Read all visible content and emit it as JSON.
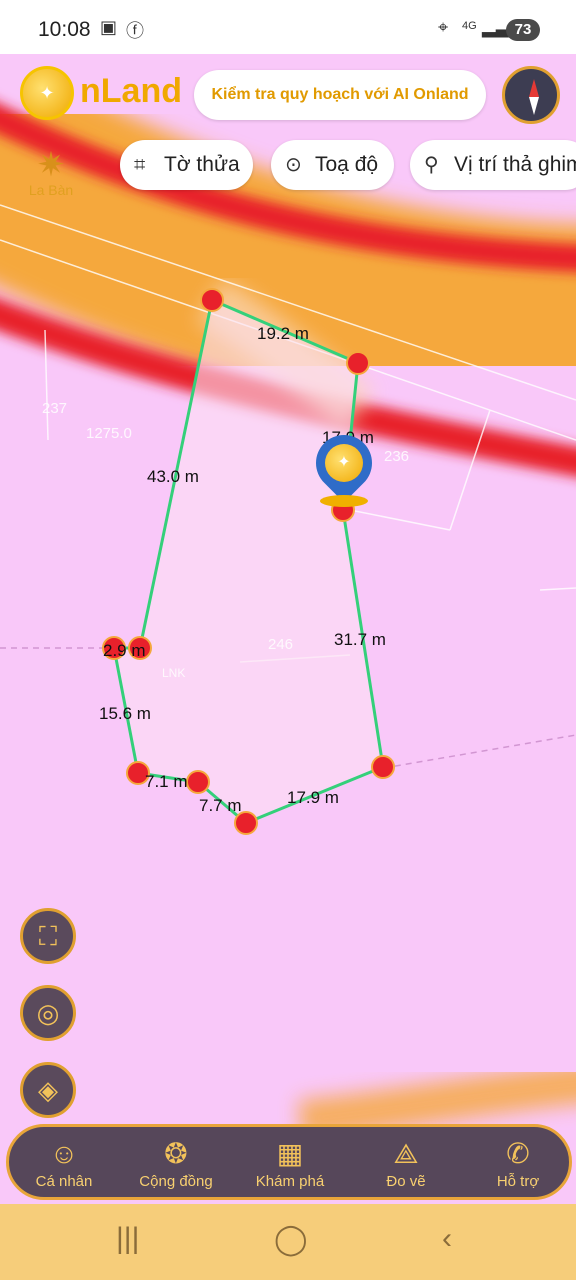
{
  "status_bar": {
    "time": "10:08",
    "network": "4G",
    "battery": "73"
  },
  "header": {
    "brand": "nLand",
    "ai_button": "Kiểm tra quy hoạch với AI Onland"
  },
  "chips": [
    {
      "label": "Tờ thửa",
      "icon": "parcel-icon"
    },
    {
      "label": "Toạ độ",
      "icon": "location-pin-icon"
    },
    {
      "label": "Vị trí thả ghim",
      "icon": "pin-drop-icon"
    }
  ],
  "compass_tool": {
    "label": "La Bàn"
  },
  "map": {
    "plot_labels": [
      "237",
      "1275.0",
      "236",
      "246",
      "LNK"
    ],
    "dimensions": [
      "19.2 m",
      "17.9 m",
      "43.0 m",
      "31.7 m",
      "2.9 m",
      "15.6 m",
      "7.1 m",
      "7.7 m",
      "17.9 m"
    ]
  },
  "fabs": [
    {
      "icon": "statistics-icon"
    },
    {
      "icon": "my-location-icon"
    },
    {
      "icon": "layers-icon"
    }
  ],
  "bottom_nav": [
    {
      "label": "Cá nhân",
      "icon": "person-icon"
    },
    {
      "label": "Cộng đồng",
      "icon": "community-icon"
    },
    {
      "label": "Khám phá",
      "icon": "explore-grid-icon"
    },
    {
      "label": "Đo vẽ",
      "icon": "measure-icon"
    },
    {
      "label": "Hỗ trợ",
      "icon": "phone-icon"
    }
  ],
  "colors": {
    "accent": "#f0a800",
    "map_bg": "#f9c8f9",
    "nav_bg": "#56475a",
    "polygon": "#34d07a"
  }
}
